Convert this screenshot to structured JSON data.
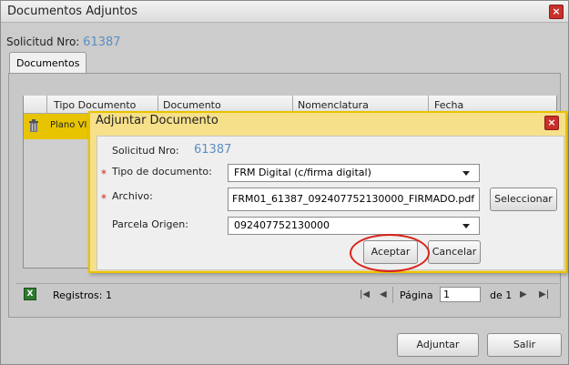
{
  "window": {
    "title": "Documentos Adjuntos",
    "close_glyph": "×"
  },
  "solicitud": {
    "label": "Solicitud Nro:",
    "value": "61387"
  },
  "tabs": [
    {
      "label": "Documentos"
    }
  ],
  "grid": {
    "columns": [
      "Tipo Documento",
      "Documento",
      "Nomenclatura",
      "Fecha"
    ],
    "rows": [
      {
        "tipo": "Plano VI"
      }
    ]
  },
  "pager": {
    "records_label": "Registros: 1",
    "page_label": "Página",
    "page_value": "1",
    "of_label": "de 1"
  },
  "footer": {
    "attach_label": "Adjuntar",
    "exit_label": "Salir"
  },
  "modal": {
    "title": "Adjuntar Documento",
    "close_glyph": "×",
    "solicitud_label": "Solicitud Nro:",
    "solicitud_value": "61387",
    "tipo_label": "Tipo de documento:",
    "tipo_value": "FRM Digital (c/firma digital)",
    "archivo_label": "Archivo:",
    "archivo_value": "FRM01_61387_092407752130000_FIRMADO.pdf",
    "select_file_label": "Seleccionar",
    "parcela_label": "Parcela Origen:",
    "parcela_value": "092407752130000",
    "accept_label": "Aceptar",
    "cancel_label": "Cancelar",
    "required_mark": "*"
  },
  "colors": {
    "accent_highlight": "#d9231b",
    "row_selected": "#e8c400",
    "modal_border": "#e9c200"
  }
}
